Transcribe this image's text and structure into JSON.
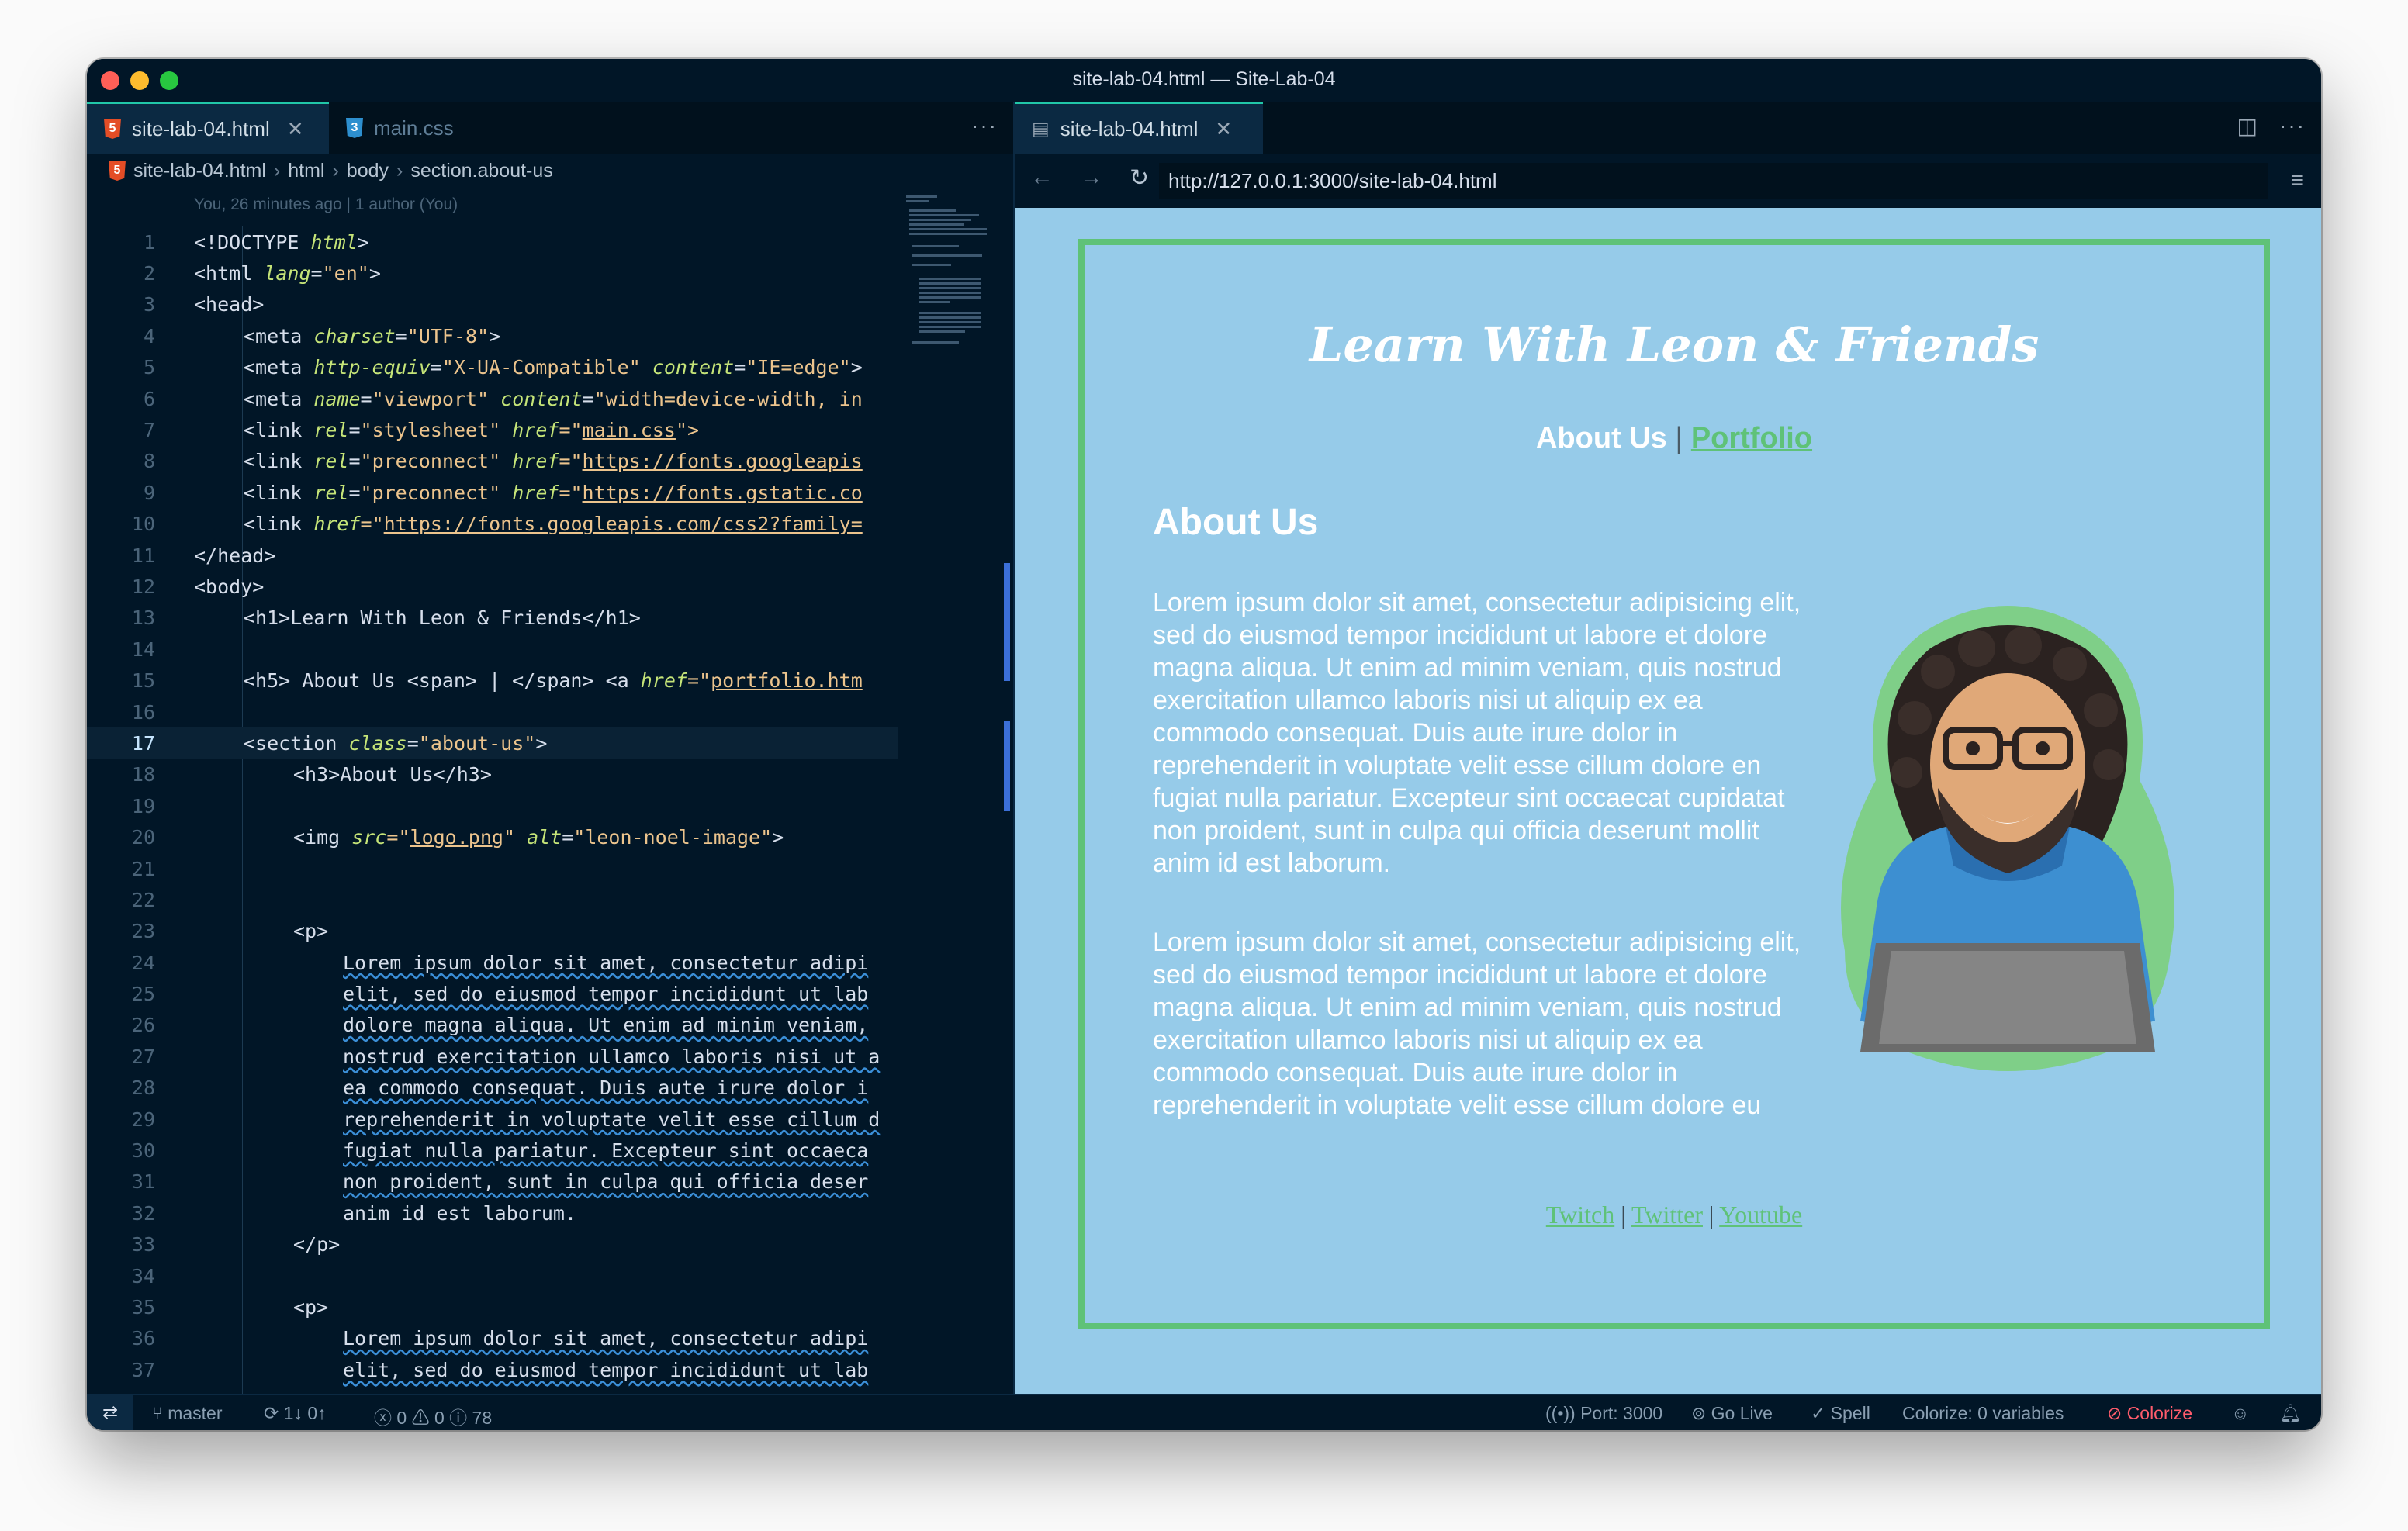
{
  "window": {
    "title": "site-lab-04.html — Site-Lab-04"
  },
  "editor": {
    "tabs": [
      {
        "label": "site-lab-04.html",
        "icon": "html5-icon",
        "active": true
      },
      {
        "label": "main.css",
        "icon": "css3-icon",
        "active": false
      }
    ],
    "more_label": "···",
    "breadcrumb": [
      "site-lab-04.html",
      "html",
      "body",
      "section.about-us"
    ],
    "blame": "You, 26 minutes ago | 1 author (You)",
    "current_line": 17,
    "line_numbers": [
      "1",
      "2",
      "3",
      "4",
      "5",
      "6",
      "7",
      "8",
      "9",
      "10",
      "11",
      "12",
      "13",
      "14",
      "15",
      "16",
      "17",
      "18",
      "19",
      "20",
      "21",
      "22",
      "23",
      "24",
      "25",
      "26",
      "27",
      "28",
      "29",
      "30",
      "31",
      "32",
      "33",
      "34",
      "35",
      "36",
      "37"
    ],
    "code": {
      "l1_a": "<!DOCTYPE ",
      "l1_b": "html",
      "l1_c": ">",
      "l2_a": "<html ",
      "l2_b": "lang",
      "l2_c": "=",
      "l2_d": "\"en\"",
      "l2_e": ">",
      "l3": "<head>",
      "l4_a": "<meta ",
      "l4_b": "charset",
      "l4_c": "=",
      "l4_d": "\"UTF-8\"",
      "l4_e": ">",
      "l5_a": "<meta ",
      "l5_b": "http-equiv",
      "l5_c": "=",
      "l5_d": "\"X-UA-Compatible\"",
      "l5_e": " ",
      "l5_f": "content",
      "l5_g": "=",
      "l5_h": "\"IE=edge\"",
      "l5_i": ">",
      "l6_a": "<meta ",
      "l6_b": "name",
      "l6_c": "=",
      "l6_d": "\"viewport\"",
      "l6_e": " ",
      "l6_f": "content",
      "l6_g": "=",
      "l6_h": "\"width=device-width, in",
      "l7_a": "<link ",
      "l7_b": "rel",
      "l7_c": "=",
      "l7_d": "\"stylesheet\"",
      "l7_e": " ",
      "l7_f": "href",
      "l7_g": "=\"",
      "l7_h": "main.css",
      "l7_i": "\">",
      "l8_a": "<link ",
      "l8_b": "rel",
      "l8_c": "=",
      "l8_d": "\"preconnect\"",
      "l8_e": " ",
      "l8_f": "href",
      "l8_g": "=\"",
      "l8_h": "https://fonts.googleapis",
      "l9_a": "<link ",
      "l9_b": "rel",
      "l9_c": "=",
      "l9_d": "\"preconnect\"",
      "l9_e": " ",
      "l9_f": "href",
      "l9_g": "=\"",
      "l9_h": "https://fonts.gstatic.co",
      "l10_a": "<link ",
      "l10_b": "href",
      "l10_c": "=\"",
      "l10_d": "https://fonts.googleapis.com/css2?family=",
      "l11": "</head>",
      "l12": "<body>",
      "l13": "<h1>Learn With Leon & Friends</h1>",
      "l15_a": "<h5> About Us <span> | </span> <a ",
      "l15_b": "href",
      "l15_c": "=\"",
      "l15_d": "portfolio.htm",
      "l17_a": "<section ",
      "l17_b": "class",
      "l17_c": "=",
      "l17_d": "\"about-us\"",
      "l17_e": ">",
      "l18": "<h3>About Us</h3>",
      "l20_a": "<img ",
      "l20_b": "src",
      "l20_c": "=\"",
      "l20_d": "logo.png",
      "l20_e": "\" ",
      "l20_f": "alt",
      "l20_g": "=",
      "l20_h": "\"leon-noel-image\"",
      "l20_i": ">",
      "l23": "<p>",
      "l24": "Lorem ipsum dolor sit amet, consectetur adipi",
      "l25": "elit, sed do eiusmod tempor incididunt ut lab",
      "l26": "dolore magna aliqua. Ut enim ad minim veniam,",
      "l27": "nostrud exercitation ullamco laboris nisi ut a",
      "l28": "ea commodo consequat. Duis aute irure dolor i",
      "l29": "reprehenderit in voluptate velit esse cillum d",
      "l30": "fugiat nulla pariatur. Excepteur sint occaeca",
      "l31": "non proident, sunt in culpa qui officia deser",
      "l32": "anim id est laborum.",
      "l33": "</p>",
      "l35": "<p>",
      "l36": "Lorem ipsum dolor sit amet, consectetur adipi",
      "l37": "elit, sed do eiusmod tempor incididunt ut lab"
    }
  },
  "preview": {
    "tab_label": "site-lab-04.html",
    "url": "http://127.0.0.1:3000/site-lab-04.html",
    "site": {
      "title": "Learn With Leon & Friends",
      "nav_about": "About Us",
      "nav_pipe": "|",
      "nav_portfolio": "Portfolio",
      "heading": "About Us",
      "para1": "Lorem ipsum dolor sit amet, consectetur adipisicing elit, sed do eiusmod tempor incididunt ut labore et dolore magna aliqua. Ut enim ad minim veniam, quis nostrud exercitation ullamco laboris nisi ut aliquip ex ea commodo consequat. Duis aute irure dolor in reprehenderit in voluptate velit esse cillum dolore en fugiat nulla pariatur. Excepteur sint occaecat cupidatat non proident, sunt in culpa qui officia deserunt mollit anim id est laborum.",
      "para2": "Lorem ipsum dolor sit amet, consectetur adipisicing elit, sed do eiusmod tempor incididunt ut labore et dolore magna aliqua. Ut enim ad minim veniam, quis nostrud exercitation ullamco laboris nisi ut aliquip ex ea commodo consequat. Duis aute irure dolor in reprehenderit in voluptate velit esse cillum dolore eu fugiat nulla pariatur. Excepteur sint occaecat cupidatat non proident, sunt in culpa qui officia deserunt mollit anim id est laborum.",
      "social": [
        "Twitch",
        "Twitter",
        "Youtube"
      ],
      "social_sep": "|"
    }
  },
  "statusbar": {
    "branch": "master",
    "sync": "1↓ 0↑",
    "problems": "0",
    "warnings": "0",
    "info": "78",
    "port": "Port: 3000",
    "golive": "Go Live",
    "spell": "Spell",
    "colorize_vars": "Colorize: 0 variables",
    "colorize": "Colorize"
  },
  "colors": {
    "site_bg": "#96cbe9",
    "frame": "#5fc278",
    "editor_bg": "#011627",
    "colorize": "#ff5c6c"
  }
}
